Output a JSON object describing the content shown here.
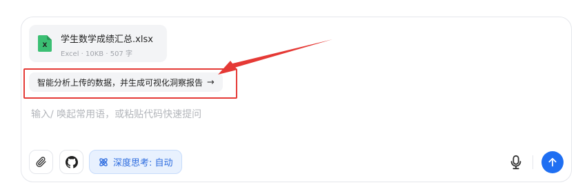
{
  "attachment": {
    "file_name": "学生数学成绩汇总.xlsx",
    "file_meta": "Excel · 10KB · 507 字",
    "file_type_letter": "X",
    "icon": "excel-file-icon"
  },
  "suggestion": {
    "label": "智能分析上传的数据，并生成可视化洞察报告",
    "arrow": "→"
  },
  "input": {
    "placeholder": "输入/ 唤起常用语，或粘贴代码快速提问"
  },
  "toolbar": {
    "attach_icon": "paperclip-icon",
    "github_icon": "github-icon",
    "deep_think_label": "深度思考: 自动",
    "mic_icon": "microphone-icon",
    "send_icon": "arrow-up-icon"
  },
  "colors": {
    "accent": "#1f6ff2",
    "annotation": "#e53935",
    "excel_green": "#2fb36b"
  }
}
